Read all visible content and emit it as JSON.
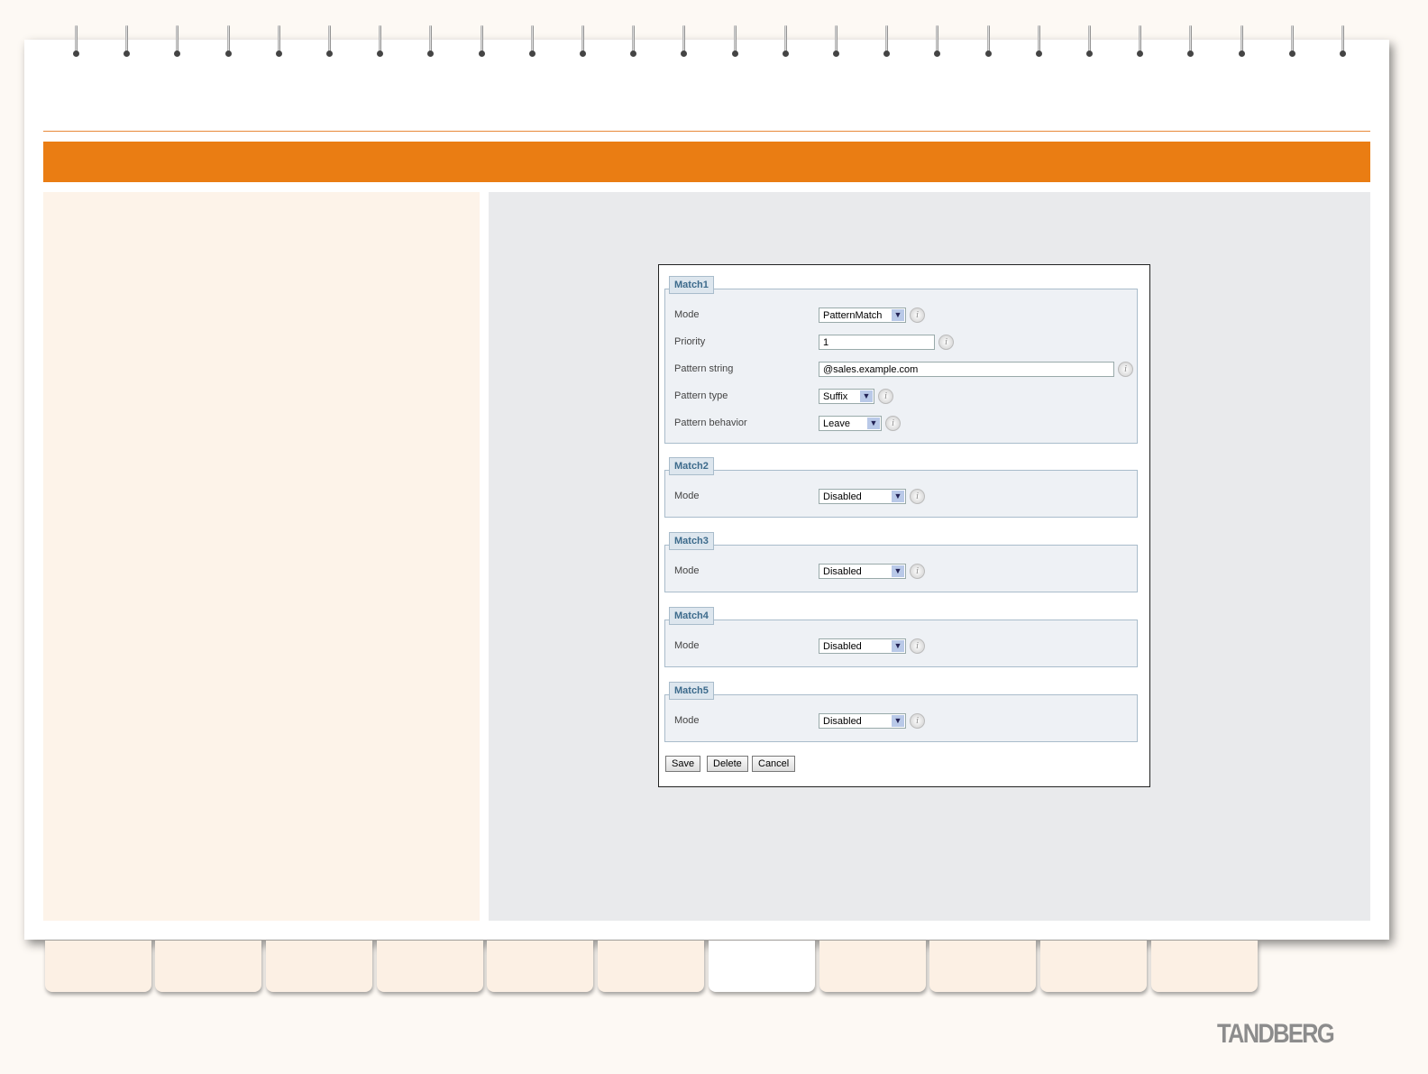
{
  "matches": [
    {
      "legend": "Match1",
      "rows": [
        {
          "label": "Mode",
          "value": "PatternMatch",
          "type": "select"
        },
        {
          "label": "Priority",
          "value": "1",
          "type": "input"
        },
        {
          "label": "Pattern string",
          "value": "@sales.example.com",
          "type": "input"
        },
        {
          "label": "Pattern type",
          "value": "Suffix",
          "type": "select"
        },
        {
          "label": "Pattern behavior",
          "value": "Leave",
          "type": "select"
        }
      ]
    },
    {
      "legend": "Match2",
      "rows": [
        {
          "label": "Mode",
          "value": "Disabled",
          "type": "select"
        }
      ]
    },
    {
      "legend": "Match3",
      "rows": [
        {
          "label": "Mode",
          "value": "Disabled",
          "type": "select"
        }
      ]
    },
    {
      "legend": "Match4",
      "rows": [
        {
          "label": "Mode",
          "value": "Disabled",
          "type": "select"
        }
      ]
    },
    {
      "legend": "Match5",
      "rows": [
        {
          "label": "Mode",
          "value": "Disabled",
          "type": "select"
        }
      ]
    }
  ],
  "buttons": {
    "save": "Save",
    "delete": "Delete",
    "cancel": "Cancel"
  },
  "info_glyph": "i",
  "logo": "TANDBERG",
  "colors": {
    "accent": "#ea7d13",
    "legend": "#3d6b8c"
  }
}
